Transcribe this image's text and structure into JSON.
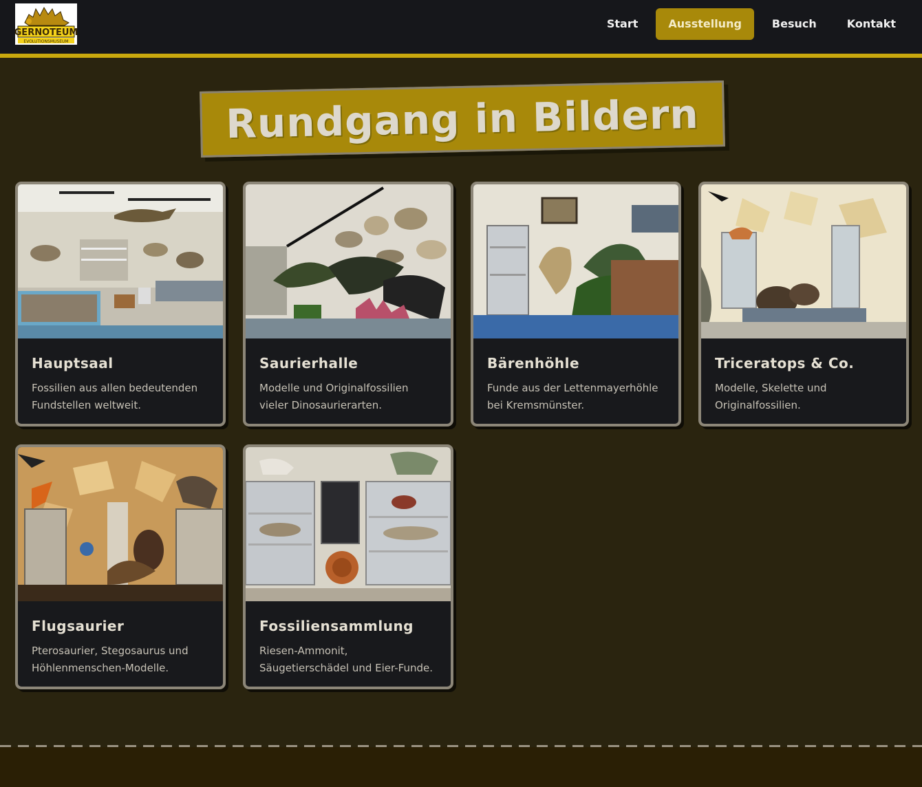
{
  "header": {
    "logo_text_top": "GERNOTEUM",
    "logo_text_bottom": "EVOLUTIONSMUSEUM",
    "nav": [
      {
        "label": "Start",
        "active": false
      },
      {
        "label": "Ausstellung",
        "active": true
      },
      {
        "label": "Besuch",
        "active": false
      },
      {
        "label": "Kontakt",
        "active": false
      }
    ]
  },
  "page": {
    "title": "Rundgang in Bildern"
  },
  "cards": [
    {
      "title": "Hauptsaal",
      "desc": "Fossilien aus allen bedeutenden Fundstellen weltweit."
    },
    {
      "title": "Saurierhalle",
      "desc": "Modelle und Originalfossilien vieler Dinosaurierarten."
    },
    {
      "title": "Bärenhöhle",
      "desc": "Funde aus der Lettenmayerhöhle bei Kremsmünster."
    },
    {
      "title": "Triceratops & Co.",
      "desc": "Modelle, Skelette und Originalfossili­en."
    },
    {
      "title": "Flugsaurier",
      "desc": "Pterosaurier, Stegosaurus und Höhlenmenschen-Modelle."
    },
    {
      "title": "Fossiliensammlung",
      "desc": "Riesen-Ammonit, Säugetierschädel und Eier-Funde."
    }
  ],
  "colors": {
    "accent": "#a8890a",
    "rule": "#c9a80e",
    "background": "#2a240f",
    "card": "#18191c"
  }
}
